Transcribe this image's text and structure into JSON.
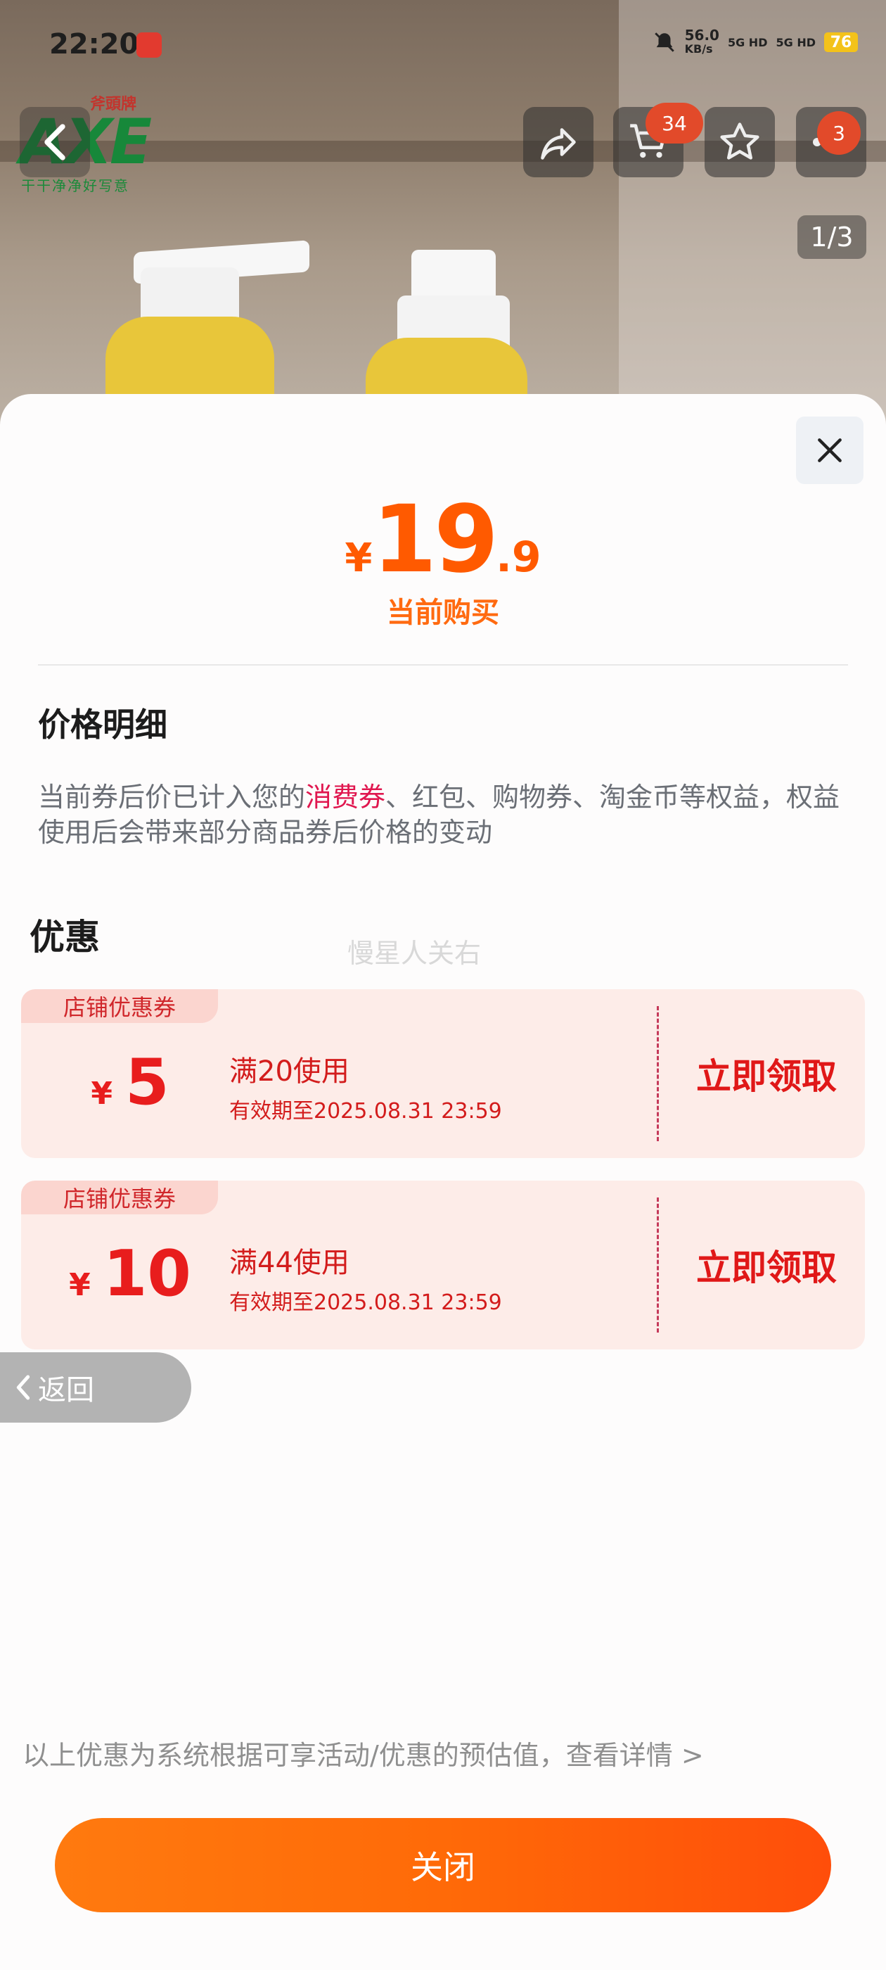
{
  "status_bar": {
    "time": "22:20",
    "net_speed_value": "56.0",
    "net_speed_unit": "KB/s",
    "signal_1": "5G HD",
    "signal_2": "5G HD",
    "battery": "76"
  },
  "brand_logo": {
    "main": "AXE",
    "chinese": "斧頭牌",
    "slogan": "干干净净好写意"
  },
  "top_nav": {
    "cart_badge": "34",
    "more_badge": "3",
    "image_pager": "1/3"
  },
  "price_sheet": {
    "currency": "¥",
    "price_int": "19",
    "price_dec": ".9",
    "price_label": "当前购买",
    "detail_title": "价格明细",
    "detail_text_before": "当前券后价已计入您的",
    "detail_text_highlight": "消费券",
    "detail_text_after": "、红包、购物券、淘金币等权益，权益使用后会带来部分商品券后价格的变动",
    "promotions_title": "优惠",
    "watermark": "慢星人关右",
    "coupons": [
      {
        "tag": "店铺优惠券",
        "currency": "¥",
        "amount": "5",
        "condition": "满20使用",
        "expiry": "有效期至2025.08.31 23:59",
        "action": "立即领取"
      },
      {
        "tag": "店铺优惠券",
        "currency": "¥",
        "amount": "10",
        "condition": "满44使用",
        "expiry": "有效期至2025.08.31 23:59",
        "action": "立即领取"
      }
    ],
    "return_label": "返回",
    "footnote": "以上优惠为系统根据可享活动/优惠的预估值，查看详情 >",
    "close_button": "关闭"
  },
  "colors": {
    "accent_orange": "#ff5a00",
    "coupon_red": "#e81d1d",
    "highlight_pink": "#e0174f"
  }
}
